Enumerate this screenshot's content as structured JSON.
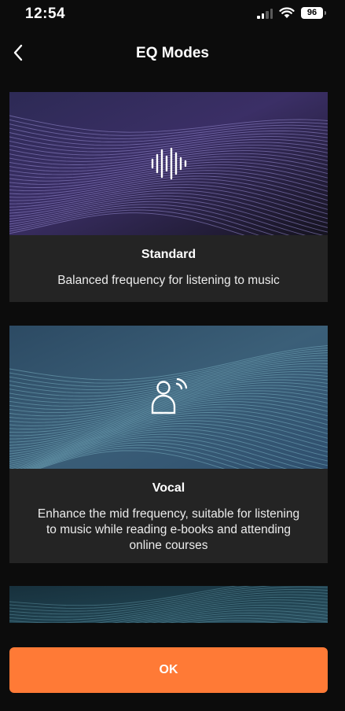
{
  "status_bar": {
    "time": "12:54",
    "battery": "96",
    "icons": [
      "signal-icon",
      "wifi-icon",
      "battery-icon"
    ]
  },
  "header": {
    "title": "EQ Modes",
    "back_icon": "chevron-left-icon"
  },
  "modes": [
    {
      "name": "Standard",
      "description": "Balanced frequency for listening to music",
      "icon": "sound-wave-icon",
      "theme": "purple"
    },
    {
      "name": "Vocal",
      "description": "Enhance the mid frequency, suitable for listening to music while reading e-books and attending online courses",
      "icon": "person-voice-icon",
      "theme": "teal"
    }
  ],
  "ok_button": {
    "label": "OK"
  },
  "colors": {
    "background": "#0c0c0c",
    "card": "#242424",
    "accent": "#ff7a36"
  }
}
